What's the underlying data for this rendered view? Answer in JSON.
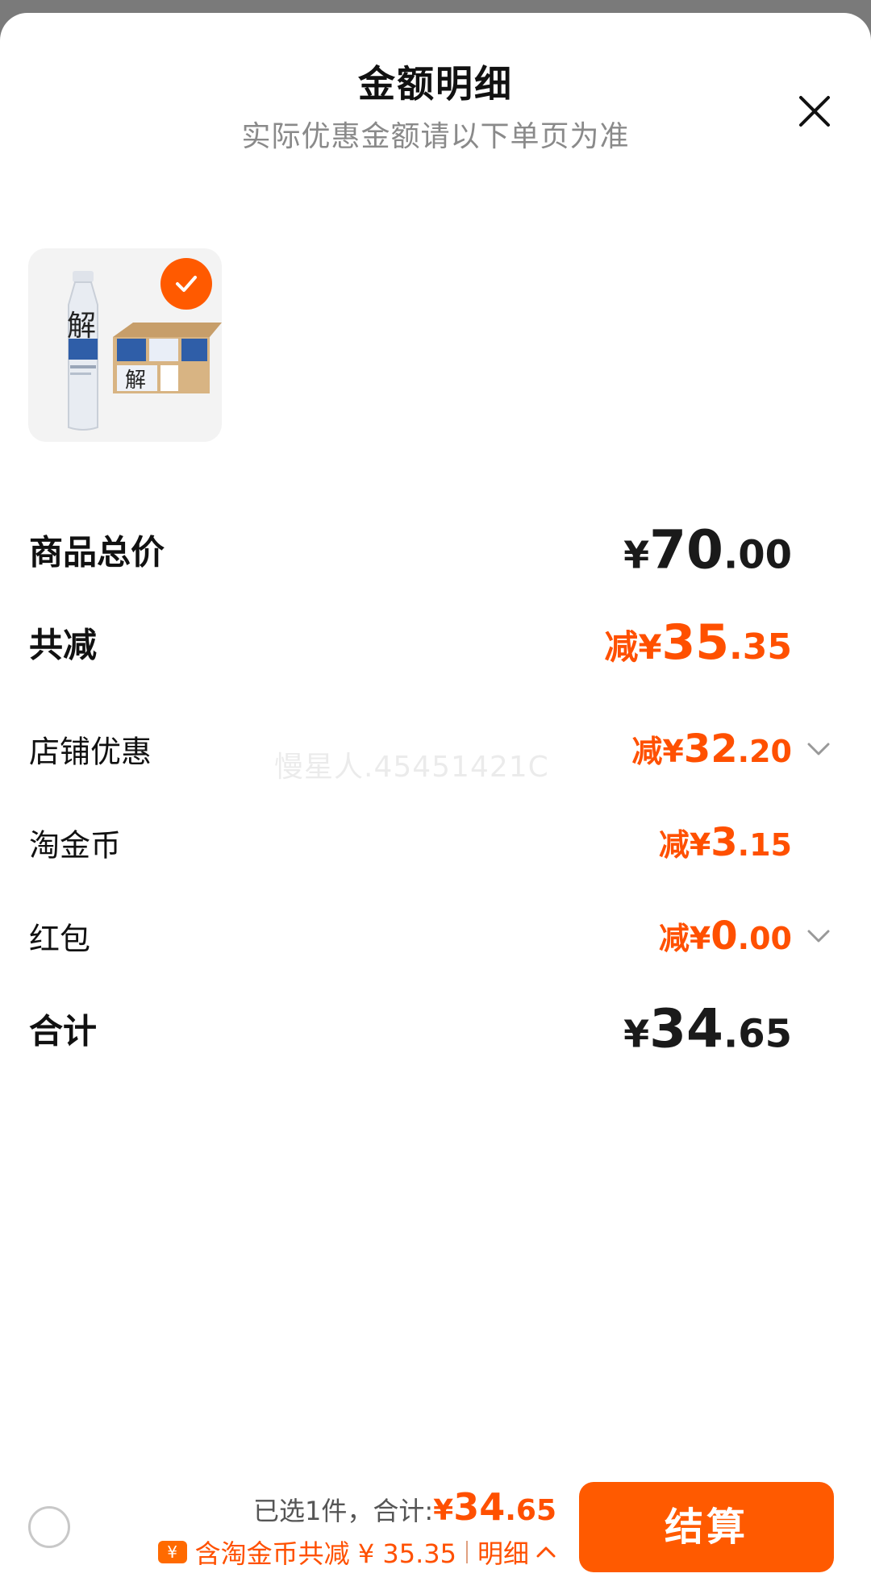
{
  "header": {
    "title": "金额明细",
    "subtitle": "实际优惠金额请以下单页为准"
  },
  "product": {
    "selected": true,
    "bottle_label": "解",
    "box_label": "解"
  },
  "breakdown": {
    "total": {
      "label": "商品总价",
      "currency": "¥",
      "int": "70",
      "dec": ".00"
    },
    "reduce_all": {
      "label": "共减",
      "prefix": "减¥",
      "int": "35",
      "dec": ".35"
    },
    "shop": {
      "label": "店铺优惠",
      "prefix": "减¥",
      "int": "32",
      "dec": ".20"
    },
    "coins": {
      "label": "淘金币",
      "prefix": "减¥",
      "int": "3",
      "dec": ".15"
    },
    "redpack": {
      "label": "红包",
      "prefix": "减¥",
      "int": "0",
      "dec": ".00"
    },
    "sum": {
      "label": "合计",
      "currency": "¥",
      "int": "34",
      "dec": ".65"
    }
  },
  "watermark": "慢星人.45451421C",
  "footer": {
    "selected_text": "已选1件，合计:",
    "currency": "¥",
    "int": "34",
    "dec": ".65",
    "coin_icon": "¥",
    "discount_text": "含淘金币共减 ¥ 35.35",
    "detail_label": "明细",
    "checkout_label": "结算"
  },
  "colors": {
    "accent": "#ff5000",
    "button": "#ff5a00"
  }
}
